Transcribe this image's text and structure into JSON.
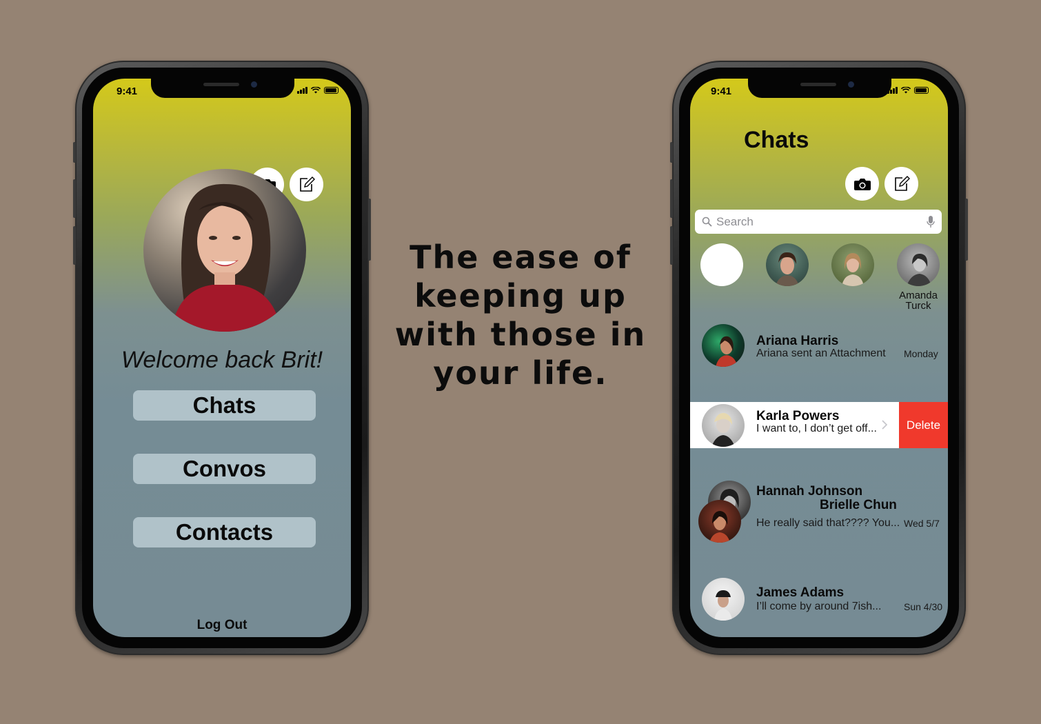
{
  "tagline": [
    "The ease of",
    "keeping up",
    "with those in",
    "your life."
  ],
  "left_phone": {
    "status_time": "9:41",
    "welcome_text": "Welcome back Brit!",
    "menu": [
      "Chats",
      "Convos",
      "Contacts"
    ],
    "logout_label": "Log Out"
  },
  "right_phone": {
    "status_time": "9:41",
    "title": "Chats",
    "search_placeholder": "Search",
    "story_name_first": "Amanda",
    "story_name_last": "Turck",
    "chats": [
      {
        "name": "Ariana Harris",
        "preview": "Ariana sent an Attachment",
        "when": "Monday"
      },
      {
        "name": "Karla Powers",
        "preview": "I want to, I don’t get off...",
        "when": ""
      },
      {
        "name": "Hannah Johnson",
        "name2": "Brielle Chun",
        "preview": "He really said that???? You...",
        "when": "Wed 5/7"
      },
      {
        "name": "James Adams",
        "preview": "I’ll come by around 7ish...",
        "when": "Sun 4/30"
      }
    ],
    "delete_label": "Delete"
  },
  "colors": {
    "background": "#958373",
    "menu_button": "#b0c2c9",
    "delete": "#f0392c",
    "gradient_top": "#d4c91a",
    "gradient_bottom": "#768b94"
  },
  "icons": [
    "camera-icon",
    "compose-icon",
    "search-icon",
    "microphone-icon",
    "chevron-right-icon"
  ]
}
